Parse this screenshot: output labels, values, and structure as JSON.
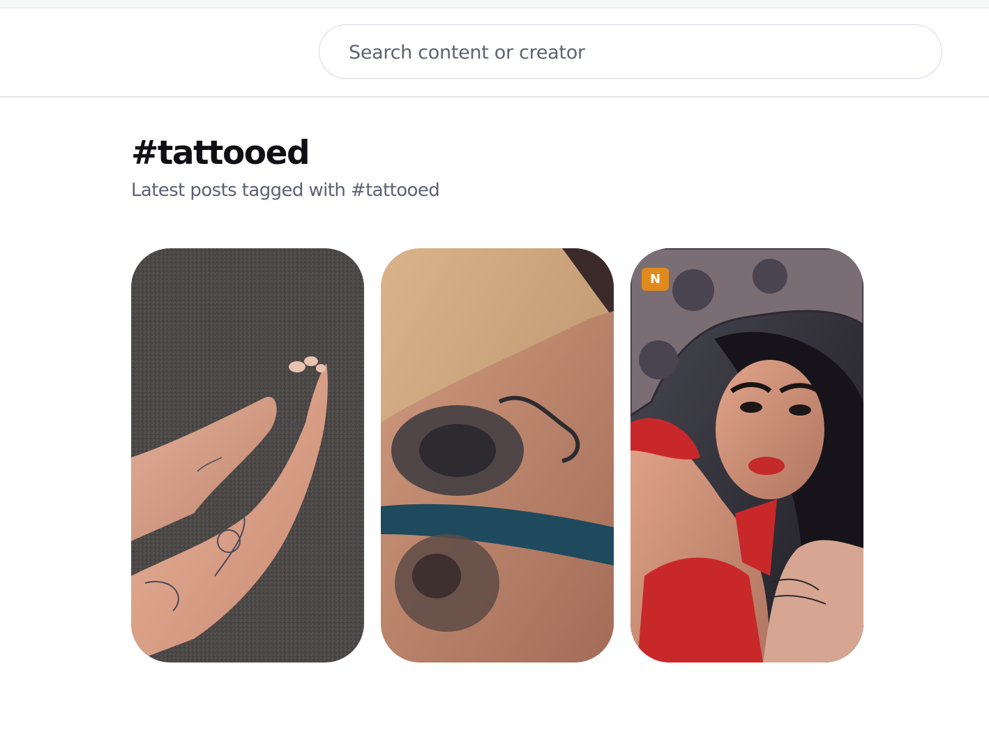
{
  "search": {
    "placeholder": "Search content or creator",
    "value": ""
  },
  "page": {
    "title": "#tattooed",
    "subtitle": "Latest posts tagged with #tattooed"
  },
  "posts": [
    {
      "image": "tattooed-feet-on-carpet",
      "badge": ""
    },
    {
      "image": "rose-thigh-tattoo",
      "badge": ""
    },
    {
      "image": "tattooed-woman-red-lingerie",
      "badge": "N"
    }
  ],
  "colors": {
    "badge": "#e08a1e",
    "title": "#0f0f14",
    "subtitle": "#5d6074",
    "header_border": "#e4e5e8"
  }
}
